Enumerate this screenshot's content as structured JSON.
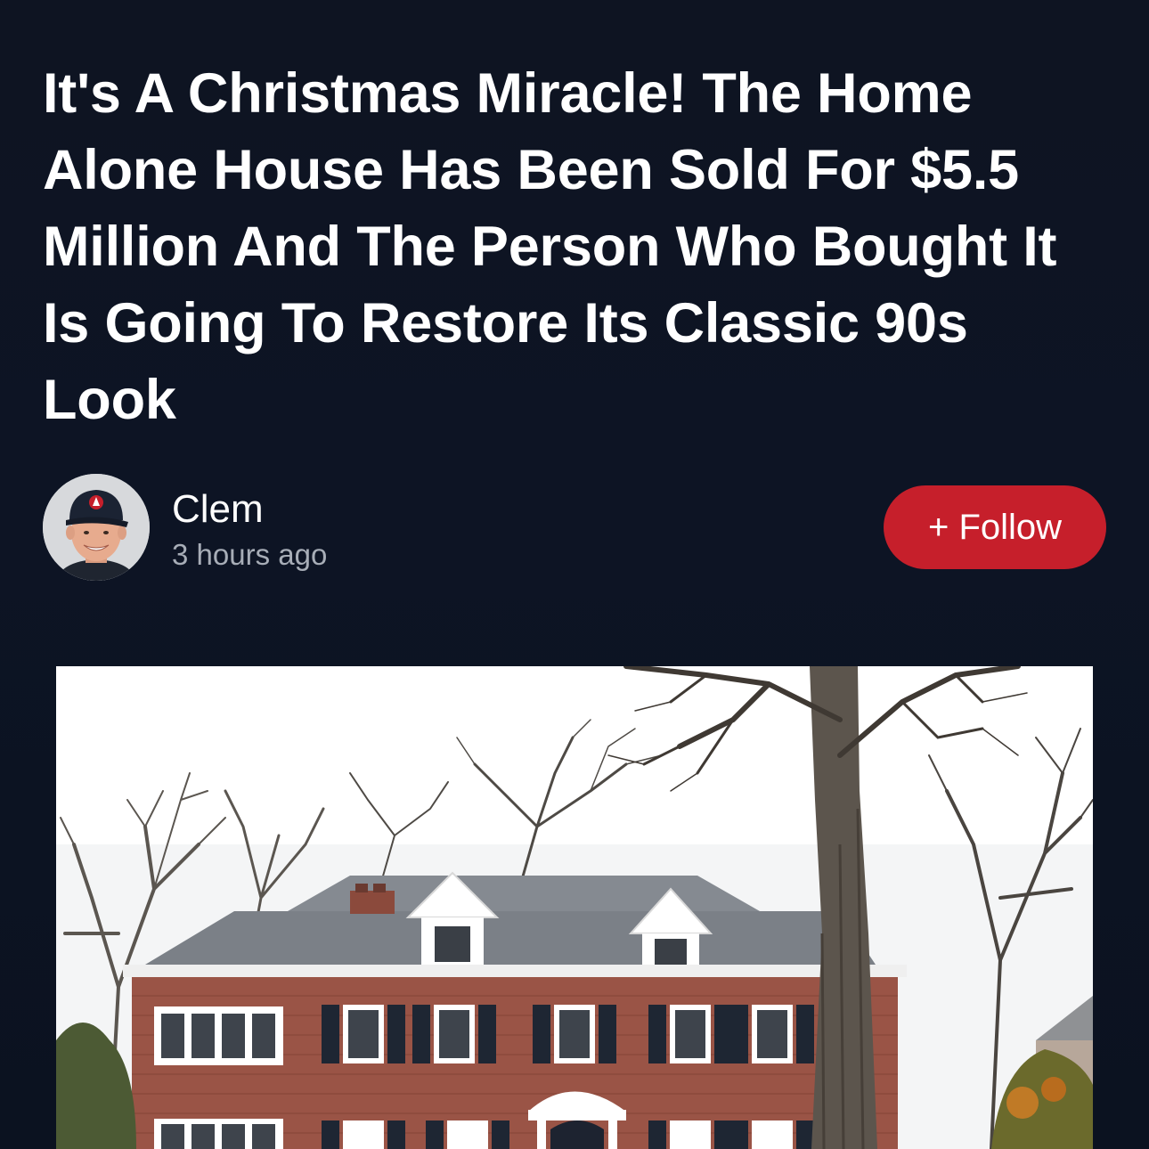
{
  "article": {
    "headline": "It's A Christmas Miracle! The Home Alone House Has Been Sold For $5.5 Million And The Person Who Bought It Is Going To Restore Its Classic 90s Look",
    "author": {
      "name": "Clem",
      "posted": "3 hours ago"
    },
    "follow_label": "+ Follow",
    "hero_image_subject": "brick-colonial-house-with-bare-trees"
  },
  "colors": {
    "background": "#0d1424",
    "follow_button": "#c61f2b",
    "text_primary": "#ffffff",
    "text_secondary": "#a7adb7"
  }
}
